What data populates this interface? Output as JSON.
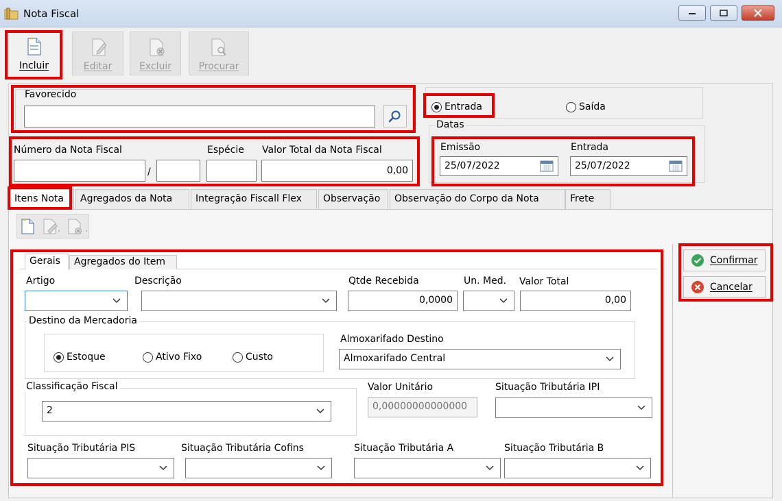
{
  "window": {
    "title": "Nota Fiscal"
  },
  "toolbar": {
    "incluir": "Incluir",
    "editar": "Editar",
    "excluir": "Excluir",
    "procurar": "Procurar"
  },
  "favorecido": {
    "label": "Favorecido",
    "value": ""
  },
  "tipo": {
    "entrada": "Entrada",
    "saida": "Saída",
    "selected": "Entrada"
  },
  "nota": {
    "numero_label": "Número da Nota Fiscal",
    "numero": "",
    "serie_sep": "/",
    "serie": "",
    "especie_label": "Espécie",
    "especie": "",
    "valor_label": "Valor Total da Nota Fiscal",
    "valor": "0,00"
  },
  "datas": {
    "title": "Datas",
    "emissao_label": "Emissão",
    "emissao": "25/07/2022",
    "entrada_label": "Entrada",
    "entrada": "25/07/2022"
  },
  "tabs": [
    {
      "label": "Itens Nota"
    },
    {
      "label": "Agregados da Nota"
    },
    {
      "label": "Integração Fiscall Flex"
    },
    {
      "label": "Observação"
    },
    {
      "label": "Observação do Corpo da Nota"
    },
    {
      "label": "Frete"
    }
  ],
  "subtabs": [
    {
      "label": "Gerais"
    },
    {
      "label": "Agregados do Item"
    }
  ],
  "item": {
    "artigo_label": "Artigo",
    "artigo": "",
    "descricao_label": "Descrição",
    "descricao": "",
    "qtde_label": "Qtde Recebida",
    "qtde": "0,0000",
    "unmed_label": "Un. Med.",
    "unmed": "",
    "valor_total_label": "Valor Total",
    "valor_total": "0,00"
  },
  "destino": {
    "title": "Destino da Mercadoria",
    "estoque": "Estoque",
    "ativo": "Ativo Fixo",
    "custo": "Custo",
    "selected": "Estoque",
    "almox_label": "Almoxarifado Destino",
    "almox": "Almoxarifado Central"
  },
  "classificacao": {
    "title": "Classificação Fiscal",
    "value": "2"
  },
  "valor_unitario": {
    "label": "Valor Unitário",
    "value": "0,00000000000000"
  },
  "situacoes": {
    "ipi_label": "Situação Tributária IPI",
    "ipi": "",
    "pis_label": "Situação Tributária PIS",
    "pis": "",
    "cofins_label": "Situação Tributária Cofins",
    "cofins": "",
    "a_label": "Situação Tributária A",
    "a": "",
    "b_label": "Situação Tributária B",
    "b": ""
  },
  "actions": {
    "confirmar": "Confirmar",
    "cancelar": "Cancelar"
  },
  "colors": {
    "highlight": "#e60000",
    "confirm": "#3aa55a",
    "cancel": "#d9442f"
  }
}
